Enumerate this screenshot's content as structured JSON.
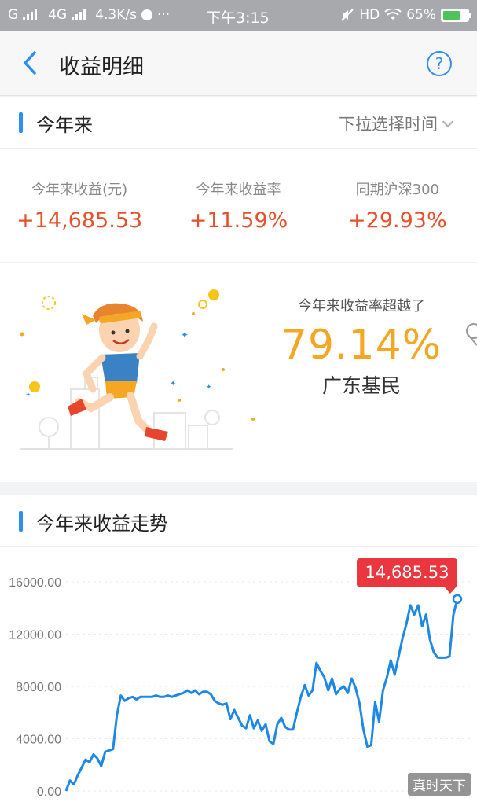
{
  "status_bar": {
    "signal1": "G",
    "signal2": "4G",
    "speed": "4.3K/s",
    "dots": "···",
    "time": "下午3:15",
    "hd": "HD",
    "battery": "65%"
  },
  "header": {
    "title": "收益明细",
    "help_label": "?"
  },
  "summary": {
    "section_title": "今年来",
    "selector_label": "下拉选择时间",
    "stats": [
      {
        "label": "今年来收益(元)",
        "value": "+14,685.53"
      },
      {
        "label": "今年来收益率",
        "value": "+11.59%"
      },
      {
        "label": "同期沪深300",
        "value": "+29.93%"
      }
    ]
  },
  "hero": {
    "label": "今年来收益率超越了",
    "percent": "79.14%",
    "group": "广东基民"
  },
  "trend": {
    "section_title": "今年来收益走势",
    "tooltip": "14,685.53"
  },
  "chart_data": {
    "type": "line",
    "title": "今年来收益走势",
    "xlabel": "",
    "ylabel": "",
    "ylim": [
      0,
      16000
    ],
    "yticks": [
      "0.00",
      "4000.00",
      "8000.00",
      "12000.00",
      "16000.00"
    ],
    "grid": true,
    "color": "#1e88e5",
    "x": [
      0,
      1,
      2,
      3,
      4,
      5,
      6,
      7,
      8,
      9,
      10,
      11,
      12,
      13,
      14,
      15,
      16,
      17,
      18,
      19,
      20,
      21,
      22,
      23,
      24,
      25,
      26,
      27,
      28,
      29,
      30,
      31,
      32,
      33,
      34,
      35,
      36,
      37,
      38,
      39,
      40,
      41,
      42,
      43,
      44,
      45,
      46,
      47,
      48,
      49,
      50,
      51,
      52,
      53,
      54,
      55,
      56,
      57,
      58,
      59,
      60,
      61,
      62,
      63,
      64,
      65,
      66,
      67,
      68,
      69,
      70,
      71,
      72,
      73,
      74,
      75,
      76,
      77,
      78,
      79,
      80,
      81,
      82,
      83,
      84,
      85,
      86,
      87,
      88,
      89,
      90,
      91,
      92,
      93,
      94,
      95,
      96,
      97,
      98,
      99,
      100
    ],
    "values": [
      0,
      800,
      500,
      1200,
      1800,
      2400,
      2200,
      2800,
      2500,
      1900,
      3000,
      3100,
      3200,
      5800,
      7300,
      6900,
      7100,
      7200,
      7000,
      7200,
      7200,
      7200,
      7200,
      7300,
      7200,
      7200,
      7300,
      7200,
      7300,
      7400,
      7500,
      7700,
      7500,
      7700,
      7400,
      7600,
      7600,
      7400,
      6900,
      6700,
      6600,
      6700,
      5500,
      6200,
      5600,
      5000,
      4800,
      5800,
      4800,
      5400,
      4600,
      5100,
      3800,
      3600,
      5100,
      5600,
      4900,
      4700,
      4700,
      6000,
      7200,
      8100,
      7300,
      7700,
      9800,
      9200,
      8700,
      7700,
      8600,
      7400,
      7800,
      8000,
      7500,
      8600,
      7900,
      6700,
      4700,
      3400,
      3500,
      6800,
      5300,
      7700,
      8700,
      10000,
      8900,
      10300,
      11700,
      12800,
      14200,
      13500,
      14200,
      12600,
      13500,
      11600,
      10600,
      10200,
      10200,
      10200,
      10300,
      13500,
      14685.53
    ]
  }
}
